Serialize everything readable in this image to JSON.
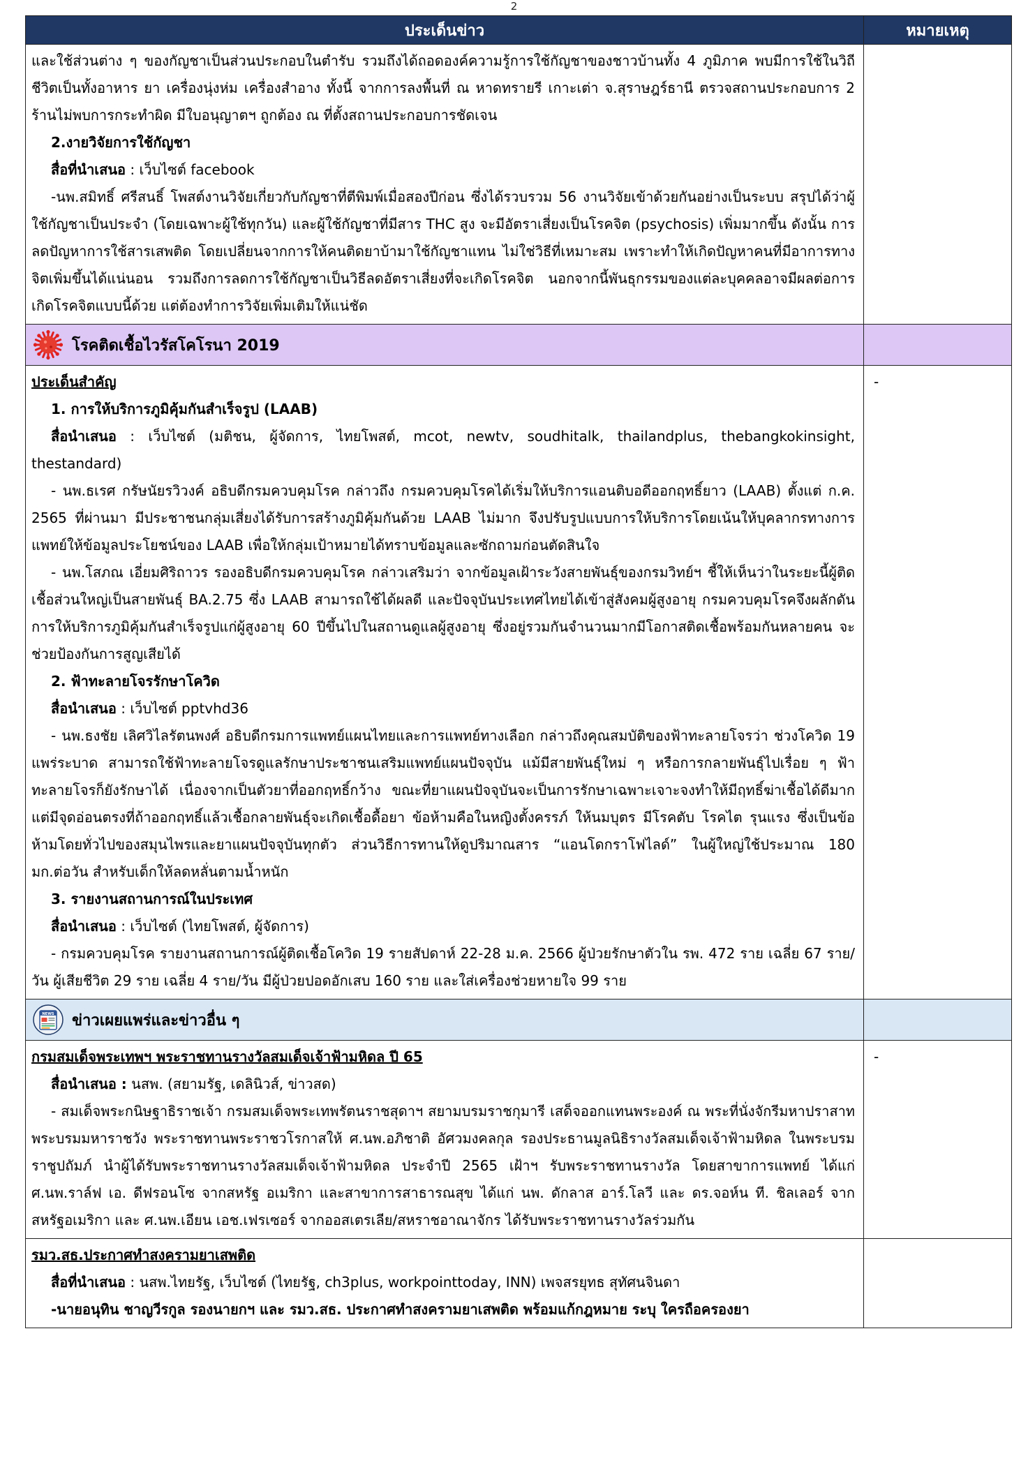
{
  "page_number": "2",
  "header": {
    "topic": "ประเด็นข่าว",
    "note": "หมายเหตุ"
  },
  "cannabis": {
    "paragraph_1": "และใช้ส่วนต่าง ๆ ของกัญชาเป็นส่วนประกอบในตำรับ รวมถึงได้ถอดองค์ความรู้การใช้กัญชาของชาวบ้านทั้ง 4 ภูมิภาค พบมีการใช้ในวิถีชีวิตเป็นทั้งอาหาร ยา เครื่องนุ่งห่ม เครื่องสำอาง ทั้งนี้ จากการลงพื้นที่ ณ หาดทรายรี เกาะเต่า จ.สุราษฎร์ธานี ตรวจสถานประกอบการ 2 ร้านไม่พบการกระทำผิด มีใบอนุญาตฯ ถูกต้อง ณ ที่ตั้งสถานประกอบการชัดเจน",
    "item_title": "2.งายวิจัยการใช้กัญชา",
    "media_label": "สื่อที่นำเสนอ",
    "media_value": " : เว็บไซต์ facebook",
    "paragraph_2": "-นพ.สมิทธิ์ ศรีสนธิ์ โพสต์งานวิจัยเกี่ยวกับกัญชาที่ตีพิมพ์เมื่อสองปีก่อน ซึ่งได้รวบรวม 56 งานวิจัยเข้าด้วยกันอย่างเป็นระบบ สรุปได้ว่าผู้ใช้กัญชาเป็นประจำ (โดยเฉพาะผู้ใช้ทุกวัน) และผู้ใช้กัญชาที่มีสาร THC สูง จะมีอัตราเสี่ยงเป็นโรคจิต (psychosis) เพิ่มมากขึ้น ดังนั้น การลดปัญหาการใช้สารเสพติด โดยเปลี่ยนจากการให้คนติดยาบ้ามาใช้กัญชาแทน ไม่ใช่วิธีที่เหมาะสม เพราะทำให้เกิดปัญหาคนที่มีอาการทางจิตเพิ่มขึ้นได้แน่นอน รวมถึงการลดการใช้กัญชาเป็นวิธีลดอัตราเสี่ยงที่จะเกิดโรคจิต นอกจากนี้พันธุกรรมของแต่ละบุคคลอาจมีผลต่อการเกิดโรคจิตแบบนี้ด้วย แต่ต้องทำการวิจัยเพิ่มเติมให้แน่ชัด"
  },
  "covid_section": {
    "title": "โรคติดเชื้อไวรัสโคโรนา 2019",
    "icon": "virus-icon",
    "color": "#dcc7f5"
  },
  "covid": {
    "heading": "ประเด็นสำคัญ",
    "note": "-",
    "item1_title": "1. การให้บริการภูมิคุ้มกันสำเร็จรูป (LAAB)",
    "item1_media_label": "สื่อนำเสนอ",
    "item1_media_value": " : เว็บไซต์ (มติชน, ผู้จัดการ, ไทยโพสต์, mcot, newtv, soudhitalk, thailandplus, thebangkokinsight, thestandard)",
    "item1_para1": "- นพ.ธเรศ กรัษนัยรวิวงค์ อธิบดีกรมควบคุมโรค กล่าวถึง กรมควบคุมโรคได้เริ่มให้บริการแอนติบอดีออกฤทธิ์ยาว (LAAB) ตั้งแต่ ก.ค. 2565 ที่ผ่านมา มีประชาชนกลุ่มเสี่ยงได้รับการสร้างภูมิคุ้มกันด้วย LAAB ไม่มาก จึงปรับรูปแบบการให้บริการโดยเน้นให้บุคลากรทางการแพทย์ให้ข้อมูลประโยชน์ของ LAAB เพื่อให้กลุ่มเป้าหมายได้ทราบข้อมูลและซักถามก่อนตัดสินใจ",
    "item1_para2": "- นพ.โสภณ เอี่ยมศิริถาวร รองอธิบดีกรมควบคุมโรค กล่าวเสริมว่า จากข้อมูลเฝ้าระวังสายพันธุ์ของกรมวิทย์ฯ ชี้ให้เห็นว่าในระยะนี้ผู้ติดเชื้อส่วนใหญ่เป็นสายพันธุ์ BA.2.75 ซึ่ง LAAB สามารถใช้ได้ผลดี และปัจจุบันประเทศไทยได้เข้าสู่สังคมผู้สูงอายุ กรมควบคุมโรคจึงผลักดันการให้บริการภูมิคุ้มกันสำเร็จรูปแก่ผู้สูงอายุ 60 ปีขึ้นไปในสถานดูแลผู้สูงอายุ ซึ่งอยู่รวมกันจำนวนมากมีโอกาสติดเชื้อพร้อมกันหลายคน จะช่วยป้องกันการสูญเสียได้",
    "item2_title": "2. ฟ้าทะลายโจรรักษาโควิด",
    "item2_media_label": "สื่อนำเสนอ",
    "item2_media_value": " : เว็บไซต์ pptvhd36",
    "item2_para": "- นพ.ธงชัย เลิศวิไลรัตนพงศ์ อธิบดีกรมการแพทย์แผนไทยและการแพทย์ทางเลือก กล่าวถึงคุณสมบัติของฟ้าทะลายโจรว่า ช่วงโควิด 19 แพร่ระบาด สามารถใช้ฟ้าทะลายโจรดูแลรักษาประชาชนเสริมแพทย์แผนปัจจุบัน แม้มีสายพันธุ์ใหม่ ๆ หรือการกลายพันธุ์ไปเรื่อย ๆ ฟ้าทะลายโจรก็ยังรักษาได้ เนื่องจากเป็นตัวยาที่ออกฤทธิ์กว้าง ขณะที่ยาแผนปัจจุบันจะเป็นการรักษาเฉพาะเจาะจงทำให้มีฤทธิ์ฆ่าเชื้อได้ดีมาก แต่มีจุดอ่อนตรงที่ถ้าออกฤทธิ์แล้วเชื้อกลายพันธุ์จะเกิดเชื้อดื้อยา ข้อห้ามคือในหญิงตั้งครรภ์ ให้นมบุตร มีโรคตับ โรคไต รุนแรง ซึ่งเป็นข้อห้ามโดยทั่วไปของสมุนไพรและยาแผนปัจจุบันทุกตัว ส่วนวิธีการทานให้ดูปริมาณสาร “แอนโดกราโฟไลด์” ในผู้ใหญ่ใช้ประมาณ 180 มก.ต่อวัน สำหรับเด็กให้ลดหลั่นตามน้ำหนัก",
    "item3_title": "3. รายงานสถานการณ์ในประเทศ",
    "item3_media_label": "สื่อนำเสนอ",
    "item3_media_value": " : เว็บไซต์ (ไทยโพสต์, ผู้จัดการ)",
    "item3_para": "- กรมควบคุมโรค รายงานสถานการณ์ผู้ติดเชื้อโควิด 19 รายสัปดาห์ 22-28 ม.ค. 2566 ผู้ป่วยรักษาตัวใน รพ. 472 ราย เฉลี่ย 67 ราย/วัน ผู้เสียชีวิต 29 ราย เฉลี่ย 4 ราย/วัน มีผู้ป่วยปอดอักเสบ 160 ราย และใส่เครื่องช่วยหายใจ 99 ราย"
  },
  "news_section": {
    "title": "ข่าวเผยแพร่และข่าวอื่น ๆ",
    "icon": "news-icon",
    "color": "#d9e7f5",
    "icon_label": "NEWS"
  },
  "award": {
    "heading": "กรมสมเด็จพระเทพฯ พระราชทานรางวัลสมเด็จเจ้าฟ้ามหิดล ปี 65",
    "note": "-",
    "media_label": "สื่อนำเสนอ :",
    "media_value": " นสพ. (สยามรัฐ, เดลินิวส์, ข่าวสด)",
    "para": "- สมเด็จพระกนิษฐาธิราชเจ้า กรมสมเด็จพระเทพรัตนราชสุดาฯ สยามบรมราชกุมารี เสด็จออกแทนพระองค์ ณ พระที่นั่งจักรีมหาปราสาท พระบรมมหาราชวัง พระราชทานพระราชวโรกาสให้ ศ.นพ.อภิชาติ อัศวมงคลกุล รองประธานมูลนิธิรางวัลสมเด็จเจ้าฟ้ามหิดล ในพระบรมราชูปถัมภ์ นำผู้ได้รับพระราชทานรางวัลสมเด็จเจ้าฟ้ามหิดล ประจำปี 2565 เฝ้าฯ รับพระราชทานรางวัล โดยสาขาการแพทย์ ได้แก่ ศ.นพ.ราล์ฟ เอ. ดีฟรอนโซ จากสหรัฐ อเมริกา และสาขาการสาธารณสุข ได้แก่ นพ. ดักลาส อาร์.โลวี และ ดร.จอห์น ที. ชิลเลอร์ จากสหรัฐอเมริกา และ ศ.นพ.เอียน เอช.เฟรเซอร์ จากออสเตรเลีย/สหราชอาณาจักร ได้รับพระราชทานรางวัลร่วมกัน"
  },
  "drugs": {
    "heading": "รมว.สธ.ประกาศทำสงครามยาเสพติด",
    "media_label": "สื่อที่นำเสนอ",
    "media_value": " : นสพ.ไทยรัฐ, เว็บไซต์ (ไทยรัฐ, ch3plus, workpointtoday, INN) เพจสรยุทธ สุทัศนจินดา",
    "para": "-นายอนุทิน ชาญวีรกูล รองนายกฯ และ รมว.สธ. ประกาศทำสงครามยาเสพติด พร้อมแก้กฎหมาย ระบุ ใครถือครองยา"
  }
}
